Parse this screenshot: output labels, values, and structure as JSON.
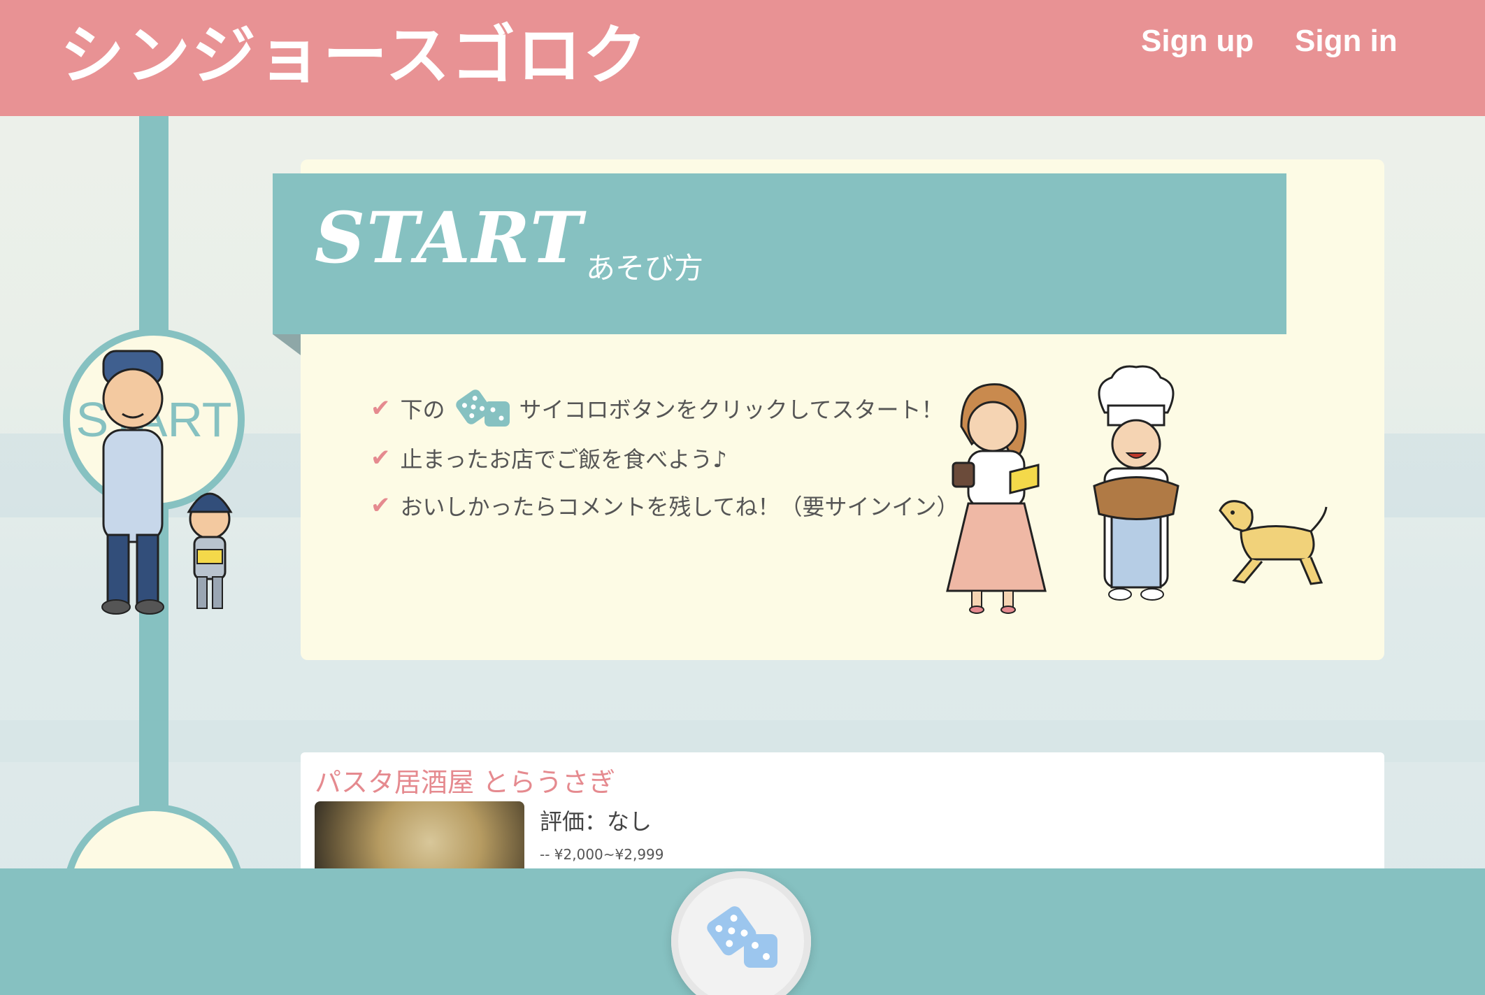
{
  "header": {
    "title": "シンジョースゴロク",
    "nav": {
      "signup": "Sign up",
      "signin": "Sign in"
    }
  },
  "board": {
    "start_label": "START"
  },
  "start_panel": {
    "title": "START",
    "subtitle": "あそび方",
    "rules": {
      "r1_before": "下の",
      "r1_after": "サイコロボタンをクリックしてスタート！",
      "r2": "止まったお店でご飯を食べよう♪",
      "r3": "おいしかったらコメントを残してね！（要サインイン）"
    }
  },
  "shop": {
    "name": "パスタ居酒屋 とらうさぎ",
    "rating": "評価：なし",
    "price": "-- ¥2,000~¥2,999"
  },
  "colors": {
    "header": "#e89294",
    "teal": "#86c1c1",
    "cream": "#fdfbe5",
    "accent": "#e58a8f"
  },
  "icons": [
    "check-icon",
    "dice-icon"
  ]
}
